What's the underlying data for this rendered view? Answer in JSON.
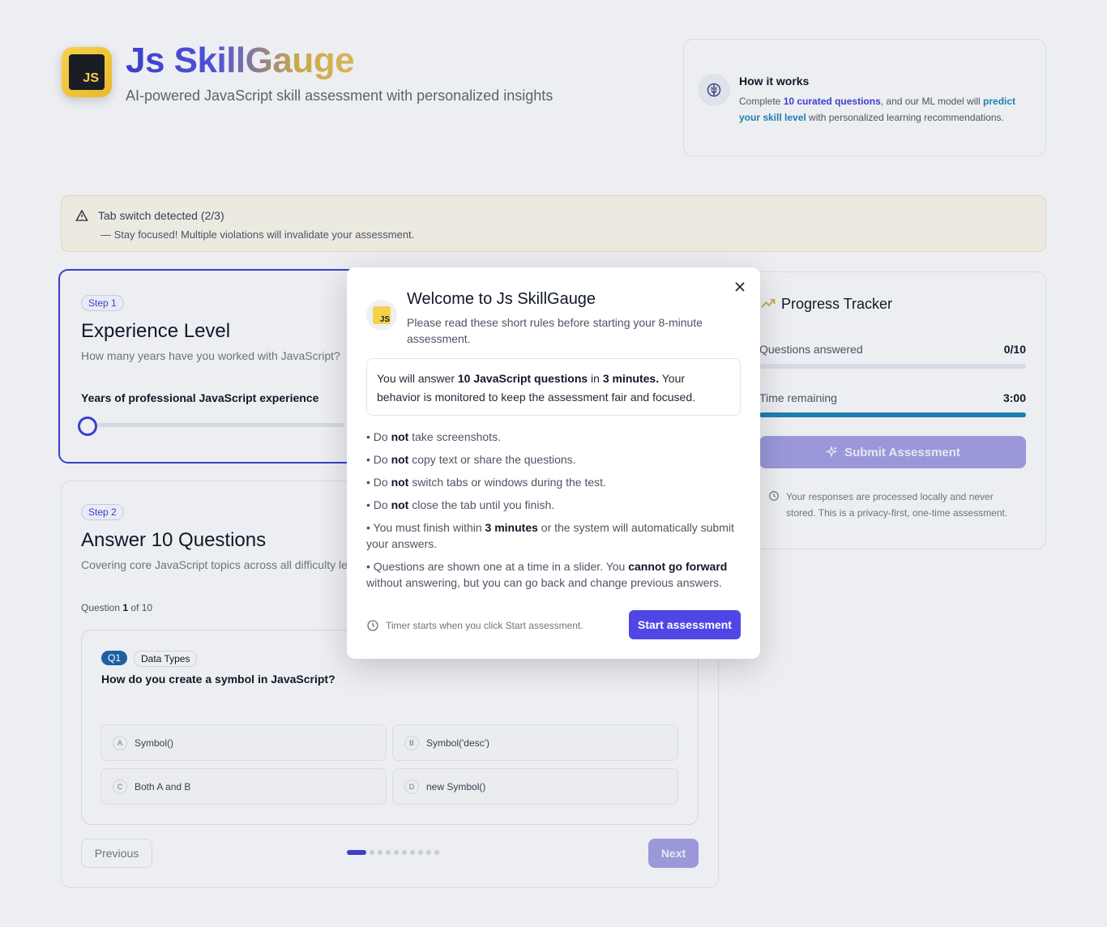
{
  "header": {
    "logo_text": "JS",
    "title": "Js SkillGauge",
    "subtitle": "AI-powered JavaScript skill assessment with personalized insights"
  },
  "how_it_works": {
    "icon": "brain-icon",
    "title": "How it works",
    "text_1": "Complete ",
    "link_1": "10 curated questions",
    "text_2": ", and our ML model will ",
    "link_2": "predict your skill level",
    "text_3": " with personalized learning recommendations."
  },
  "warning": {
    "icon": "warning-triangle-icon",
    "title": "Tab switch detected (2/3)",
    "text": "— Stay focused! Multiple violations will invalidate your assessment."
  },
  "step1": {
    "pill": "Step 1",
    "title": "Experience Level",
    "subtitle": "How many years have you worked with JavaScript?",
    "slider_label": "Years of professional JavaScript experience"
  },
  "step2": {
    "pill": "Step 2",
    "title": "Answer 10 Questions",
    "subtitle": "Covering core JavaScript topics across all difficulty lev",
    "question_counter_prefix": "Question ",
    "question_counter_current": "1",
    "question_counter_suffix": " of 10",
    "question": {
      "badge": "Q1",
      "topic": "Data Types",
      "text": "How do you create a symbol in JavaScript?",
      "options": [
        {
          "letter": "A",
          "text": "Symbol()"
        },
        {
          "letter": "B",
          "text": "Symbol('desc')"
        },
        {
          "letter": "C",
          "text": "Both A and B"
        },
        {
          "letter": "D",
          "text": "new Symbol()"
        }
      ]
    },
    "prev_label": "Previous",
    "next_label": "Next",
    "active_dot": 1,
    "total_dots": 10
  },
  "progress": {
    "icon": "trending-up-icon",
    "title": "Progress Tracker",
    "answered_label": "Questions answered",
    "answered_value": "0/10",
    "answered_fraction": 0,
    "time_label": "Time remaining",
    "time_value": "3:00",
    "time_fraction": 1,
    "submit_label": "Submit Assessment",
    "note": "Your responses are processed locally and never stored. This is a privacy-first, one-time assessment."
  },
  "modal": {
    "title": "Welcome to Js SkillGauge",
    "subtitle": "Please read these short rules before starting your 8-minute assessment.",
    "box_1": "You will answer ",
    "box_2": "10 JavaScript questions",
    "box_3": " in ",
    "box_4": "3 minutes.",
    "box_5": " Your behavior is monitored to keep the assessment fair and focused.",
    "rules": [
      {
        "a": "• Do ",
        "b": "not",
        "c": " take screenshots."
      },
      {
        "a": "• Do ",
        "b": "not",
        "c": " copy text or share the questions."
      },
      {
        "a": "• Do ",
        "b": "not",
        "c": " switch tabs or windows during the test."
      },
      {
        "a": "• Do ",
        "b": "not",
        "c": " close the tab until you finish."
      },
      {
        "a": "• You must finish within ",
        "b": "3 minutes",
        "c": " or the system will automatically submit your answers."
      },
      {
        "a": "• Questions are shown one at a time in a slider. You ",
        "b": "cannot go forward",
        "c": " without answering, but you can go back and change previous answers."
      }
    ],
    "footer_note": "Timer starts when you click Start assessment.",
    "start_label": "Start assessment"
  },
  "colors": {
    "accent": "#4f46e5",
    "brand_indigo": "#3b3fc9",
    "cyan": "#1f7fae",
    "logo_yellow": "#f6d24a"
  }
}
